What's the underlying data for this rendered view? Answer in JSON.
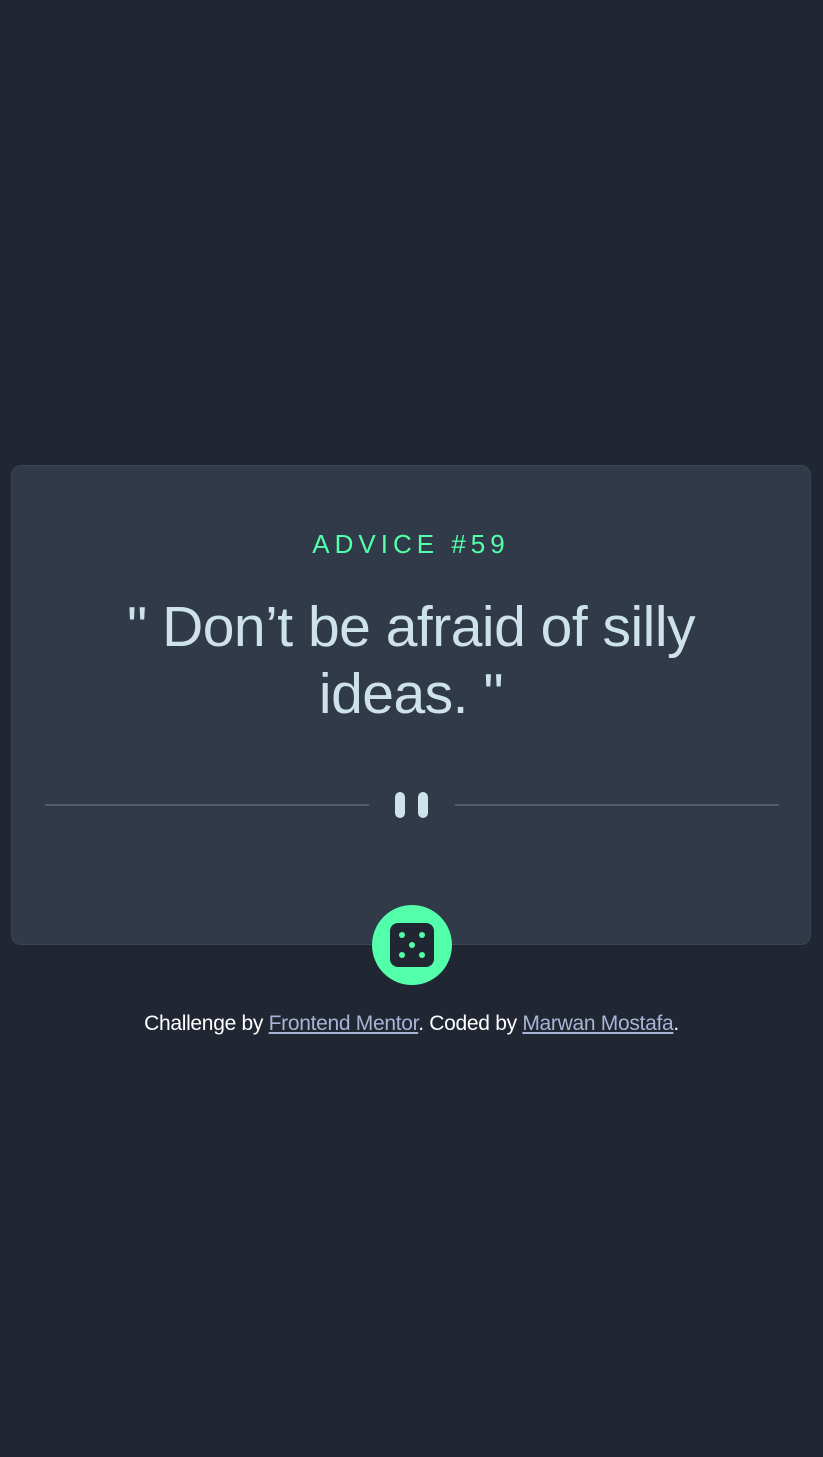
{
  "advice": {
    "heading": "ADVICE #59",
    "quote": "\" Don’t be afraid of silly ideas. \""
  },
  "dice_button": {
    "icon": "dice-icon"
  },
  "footer": {
    "prefix": "Challenge by",
    "link1": "Frontend Mentor",
    "middle": ". Coded by",
    "link2": "Marwan Mostafa",
    "suffix": "."
  },
  "colors": {
    "background": "#202632",
    "card": "#313a49",
    "accent": "#53ffaa",
    "quote_text": "#cee3e9",
    "link": "#a9b3d4"
  }
}
